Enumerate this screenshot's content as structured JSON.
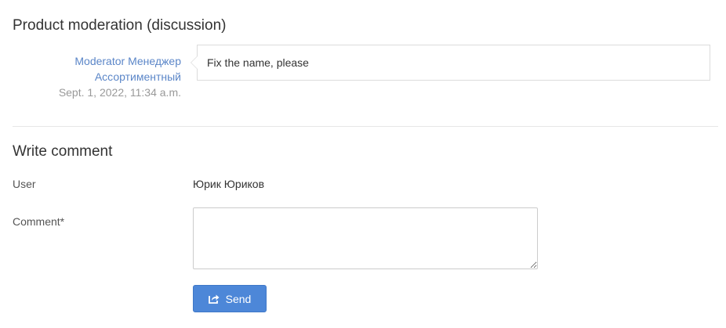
{
  "discussion": {
    "title": "Product moderation (discussion)",
    "comment": {
      "author": "Moderator Менеджер Ассортиментный",
      "date": "Sept. 1, 2022, 11:34 a.m.",
      "text": "Fix the name, please"
    }
  },
  "write": {
    "title": "Write comment",
    "user_label": "User",
    "user_value": "Юрик Юриков",
    "comment_label": "Comment*",
    "comment_value": "",
    "send_label": "Send",
    "send_icon": "share-icon"
  },
  "colors": {
    "accent": "#4d87d8",
    "link": "#5b86c8",
    "muted": "#999999"
  }
}
